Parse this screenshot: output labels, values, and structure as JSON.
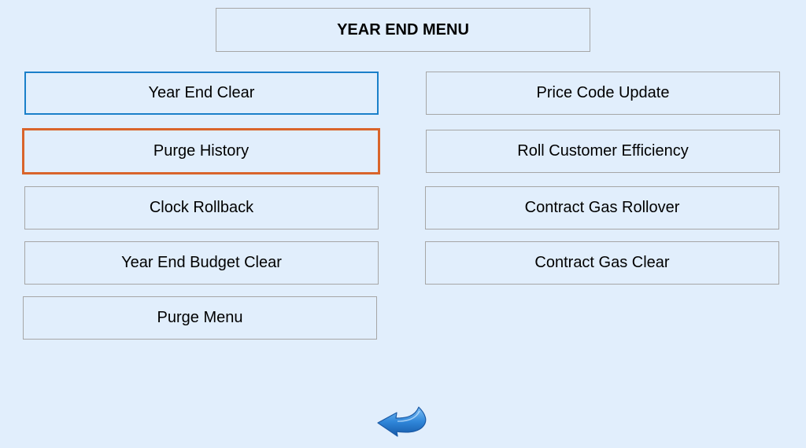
{
  "header": {
    "title": "YEAR END MENU"
  },
  "left_column": {
    "year_end_clear": "Year End Clear",
    "purge_history": "Purge History",
    "clock_rollback": "Clock Rollback",
    "year_end_budget_clear": "Year End Budget Clear",
    "purge_menu": "Purge Menu"
  },
  "right_column": {
    "price_code_update": "Price Code Update",
    "roll_customer_efficiency": "Roll Customer Efficiency",
    "contract_gas_rollover": "Contract Gas Rollover",
    "contract_gas_clear": "Contract Gas Clear"
  },
  "back": {
    "icon": "back-arrow-icon"
  },
  "colors": {
    "background": "#e1eefc",
    "hover_border": "#1a7fc9",
    "focus_border": "#d9642b",
    "arrow_blue": "#2b7fd4"
  }
}
